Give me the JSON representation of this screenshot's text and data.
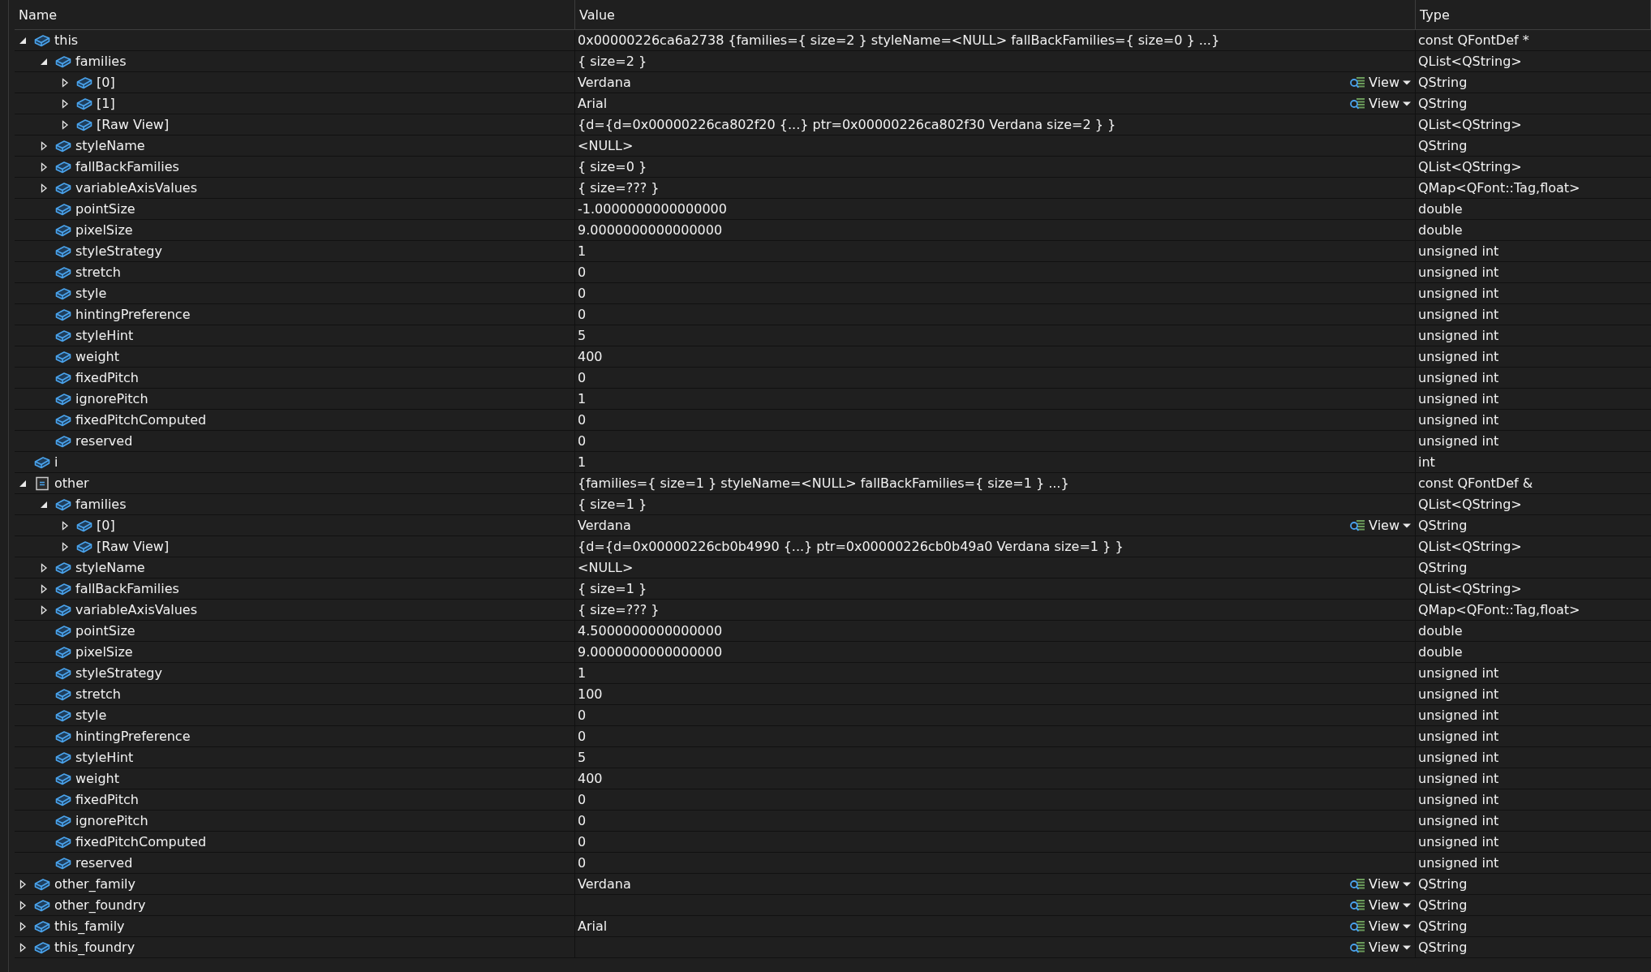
{
  "columns": [
    "Name",
    "Value",
    "Type"
  ],
  "rows": [
    {
      "name": "this",
      "value": "0x00000226ca6a2738 {families={ size=2 } styleName=<NULL> fallBackFamilies={ size=0 } ...}",
      "type": "const QFontDef *",
      "kind": "field",
      "expanded": true,
      "children": [
        {
          "name": "families",
          "value": "{ size=2 }",
          "type": "QList<QString>",
          "kind": "field",
          "expanded": true,
          "children": [
            {
              "name": "[0]",
              "value": "Verdana",
              "type": "QString",
              "kind": "field",
              "expanded": false,
              "visualizer": "View"
            },
            {
              "name": "[1]",
              "value": "Arial",
              "type": "QString",
              "kind": "field",
              "expanded": false,
              "visualizer": "View"
            },
            {
              "name": "[Raw View]",
              "value": "{d={d=0x00000226ca802f20 {...} ptr=0x00000226ca802f30 Verdana size=2 } }",
              "type": "QList<QString>",
              "kind": "field",
              "expanded": false
            }
          ]
        },
        {
          "name": "styleName",
          "value": "<NULL>",
          "type": "QString",
          "kind": "field",
          "expanded": false
        },
        {
          "name": "fallBackFamilies",
          "value": "{ size=0 }",
          "type": "QList<QString>",
          "kind": "field",
          "expanded": false
        },
        {
          "name": "variableAxisValues",
          "value": "{ size=??? }",
          "type": "QMap<QFont::Tag,float>",
          "kind": "field",
          "expanded": false
        },
        {
          "name": "pointSize",
          "value": "-1.0000000000000000",
          "type": "double",
          "kind": "field"
        },
        {
          "name": "pixelSize",
          "value": "9.0000000000000000",
          "type": "double",
          "kind": "field"
        },
        {
          "name": "styleStrategy",
          "value": "1",
          "type": "unsigned int",
          "kind": "field"
        },
        {
          "name": "stretch",
          "value": "0",
          "type": "unsigned int",
          "kind": "field"
        },
        {
          "name": "style",
          "value": "0",
          "type": "unsigned int",
          "kind": "field"
        },
        {
          "name": "hintingPreference",
          "value": "0",
          "type": "unsigned int",
          "kind": "field"
        },
        {
          "name": "styleHint",
          "value": "5",
          "type": "unsigned int",
          "kind": "field"
        },
        {
          "name": "weight",
          "value": "400",
          "type": "unsigned int",
          "kind": "field"
        },
        {
          "name": "fixedPitch",
          "value": "0",
          "type": "unsigned int",
          "kind": "field"
        },
        {
          "name": "ignorePitch",
          "value": "1",
          "type": "unsigned int",
          "kind": "field"
        },
        {
          "name": "fixedPitchComputed",
          "value": "0",
          "type": "unsigned int",
          "kind": "field"
        },
        {
          "name": "reserved",
          "value": "0",
          "type": "unsigned int",
          "kind": "field"
        }
      ]
    },
    {
      "name": "i",
      "value": "1",
      "type": "int",
      "kind": "field"
    },
    {
      "name": "other",
      "value": "{families={ size=1 } styleName=<NULL> fallBackFamilies={ size=1 } ...}",
      "type": "const QFontDef &",
      "kind": "struct",
      "expanded": true,
      "children": [
        {
          "name": "families",
          "value": "{ size=1 }",
          "type": "QList<QString>",
          "kind": "field",
          "expanded": true,
          "children": [
            {
              "name": "[0]",
              "value": "Verdana",
              "type": "QString",
              "kind": "field",
              "expanded": false,
              "visualizer": "View"
            },
            {
              "name": "[Raw View]",
              "value": "{d={d=0x00000226cb0b4990 {...} ptr=0x00000226cb0b49a0 Verdana size=1 } }",
              "type": "QList<QString>",
              "kind": "field",
              "expanded": false
            }
          ]
        },
        {
          "name": "styleName",
          "value": "<NULL>",
          "type": "QString",
          "kind": "field",
          "expanded": false
        },
        {
          "name": "fallBackFamilies",
          "value": "{ size=1 }",
          "type": "QList<QString>",
          "kind": "field",
          "expanded": false
        },
        {
          "name": "variableAxisValues",
          "value": "{ size=??? }",
          "type": "QMap<QFont::Tag,float>",
          "kind": "field",
          "expanded": false
        },
        {
          "name": "pointSize",
          "value": "4.5000000000000000",
          "type": "double",
          "kind": "field"
        },
        {
          "name": "pixelSize",
          "value": "9.0000000000000000",
          "type": "double",
          "kind": "field"
        },
        {
          "name": "styleStrategy",
          "value": "1",
          "type": "unsigned int",
          "kind": "field"
        },
        {
          "name": "stretch",
          "value": "100",
          "type": "unsigned int",
          "kind": "field"
        },
        {
          "name": "style",
          "value": "0",
          "type": "unsigned int",
          "kind": "field"
        },
        {
          "name": "hintingPreference",
          "value": "0",
          "type": "unsigned int",
          "kind": "field"
        },
        {
          "name": "styleHint",
          "value": "5",
          "type": "unsigned int",
          "kind": "field"
        },
        {
          "name": "weight",
          "value": "400",
          "type": "unsigned int",
          "kind": "field"
        },
        {
          "name": "fixedPitch",
          "value": "0",
          "type": "unsigned int",
          "kind": "field"
        },
        {
          "name": "ignorePitch",
          "value": "0",
          "type": "unsigned int",
          "kind": "field"
        },
        {
          "name": "fixedPitchComputed",
          "value": "0",
          "type": "unsigned int",
          "kind": "field"
        },
        {
          "name": "reserved",
          "value": "0",
          "type": "unsigned int",
          "kind": "field"
        }
      ]
    },
    {
      "name": "other_family",
      "value": "Verdana",
      "type": "QString",
      "kind": "field",
      "expanded": false,
      "visualizer": "View"
    },
    {
      "name": "other_foundry",
      "type": "QString",
      "kind": "field",
      "expanded": false,
      "visualizer": "View"
    },
    {
      "name": "this_family",
      "value": "Arial",
      "type": "QString",
      "kind": "field",
      "expanded": false,
      "visualizer": "View"
    },
    {
      "name": "this_foundry",
      "type": "QString",
      "kind": "field",
      "expanded": false,
      "visualizer": "View"
    }
  ]
}
